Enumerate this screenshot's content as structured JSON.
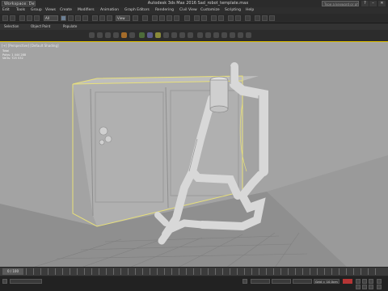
{
  "titlebar": {
    "workspace": "Workspace: Default",
    "title": "Autodesk 3ds Max 2016   Sad_robot_template.max",
    "search_placeholder": "Type a keyword or phrase"
  },
  "menu": {
    "items": [
      "Edit",
      "Tools",
      "Group",
      "Views",
      "Create",
      "Modifiers",
      "Animation",
      "Graph Editors",
      "Rendering",
      "Civil View",
      "Customize",
      "Scripting",
      "Help"
    ]
  },
  "toolbar": {
    "filter_value": "All",
    "view_value": "View"
  },
  "ribbon": {
    "tabs": [
      "Selection",
      "Object Paint",
      "Populate"
    ]
  },
  "viewport": {
    "label": "[+] [Perspective] [Default Shading]",
    "stats_label": "Total",
    "stats_polys": "Polys: 1 444 288",
    "stats_verts": "Verts: 725 532"
  },
  "timeline": {
    "frame_label": "0 / 100"
  },
  "statusbar": {
    "grid_value": "Grid = 10,0cm"
  },
  "colors": {
    "selection": "#e8e07a",
    "viewport_bg": "#a6a6a6",
    "ui_dark": "#262626",
    "autokey": "#b53535"
  }
}
